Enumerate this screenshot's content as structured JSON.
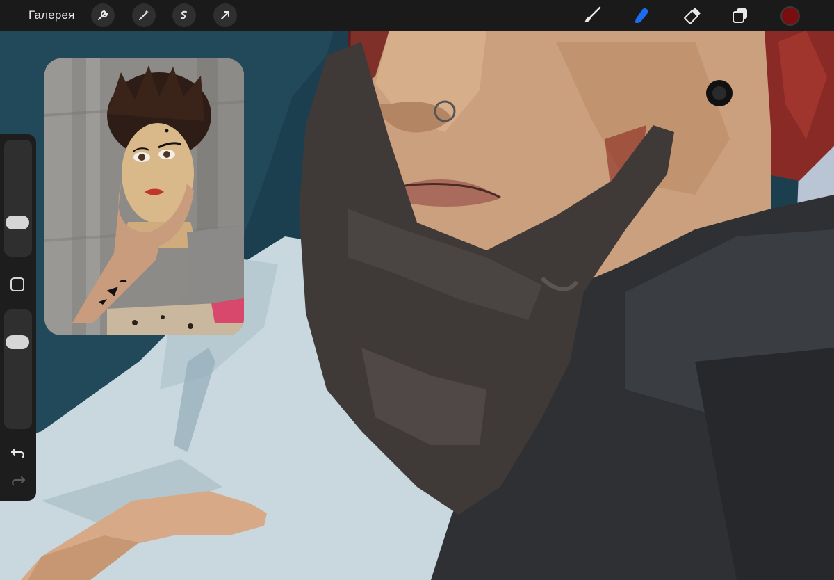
{
  "toolbar": {
    "gallery_label": "Галерея",
    "left_tools": [
      {
        "name": "wrench-icon"
      },
      {
        "name": "magic-wand-icon"
      },
      {
        "name": "selection-icon"
      },
      {
        "name": "move-arrow-icon"
      }
    ],
    "right_tools": [
      {
        "name": "brush-icon",
        "active": false
      },
      {
        "name": "smudge-icon",
        "active": true
      },
      {
        "name": "eraser-icon",
        "active": false
      },
      {
        "name": "layers-icon",
        "active": false
      }
    ],
    "current_color": "#7a0d10",
    "active_color": "#1c6cf0"
  },
  "sidebar": {
    "brush_size_level": 0.25,
    "opacity_level": 0.77
  },
  "colors": {
    "background_teal": "#1c3f4f",
    "shirt_light": "#c8d8de",
    "jacket_dark": "#2e3033",
    "skin": "#caa07e",
    "hair_red": "#8a2a26",
    "glove": "#3f3a38"
  }
}
